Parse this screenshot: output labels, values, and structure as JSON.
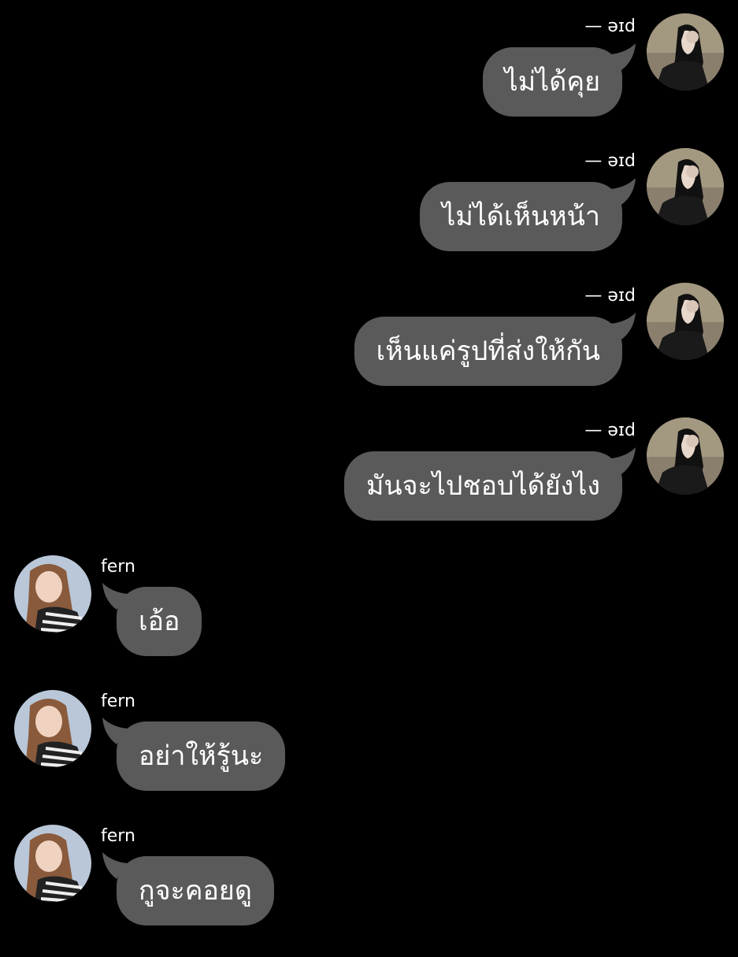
{
  "messages": [
    {
      "side": "right",
      "sender": "— əɪd",
      "text": "ไม่ได้คุย"
    },
    {
      "side": "right",
      "sender": "— əɪd",
      "text": "ไม่ได้เห็นหน้า"
    },
    {
      "side": "right",
      "sender": "— əɪd",
      "text": "เห็นแค่รูปที่ส่งให้กัน"
    },
    {
      "side": "right",
      "sender": "— əɪd",
      "text": "มันจะไปชอบได้ยังไง"
    },
    {
      "side": "left",
      "sender": "fern",
      "text": "เอ้อ"
    },
    {
      "side": "left",
      "sender": "fern",
      "text": "อย่าให้รู้นะ"
    },
    {
      "side": "left",
      "sender": "fern",
      "text": "กูจะคอยดู"
    }
  ],
  "colors": {
    "background": "#000000",
    "bubble": "#5a5a5a",
    "text": "#ffffff"
  }
}
